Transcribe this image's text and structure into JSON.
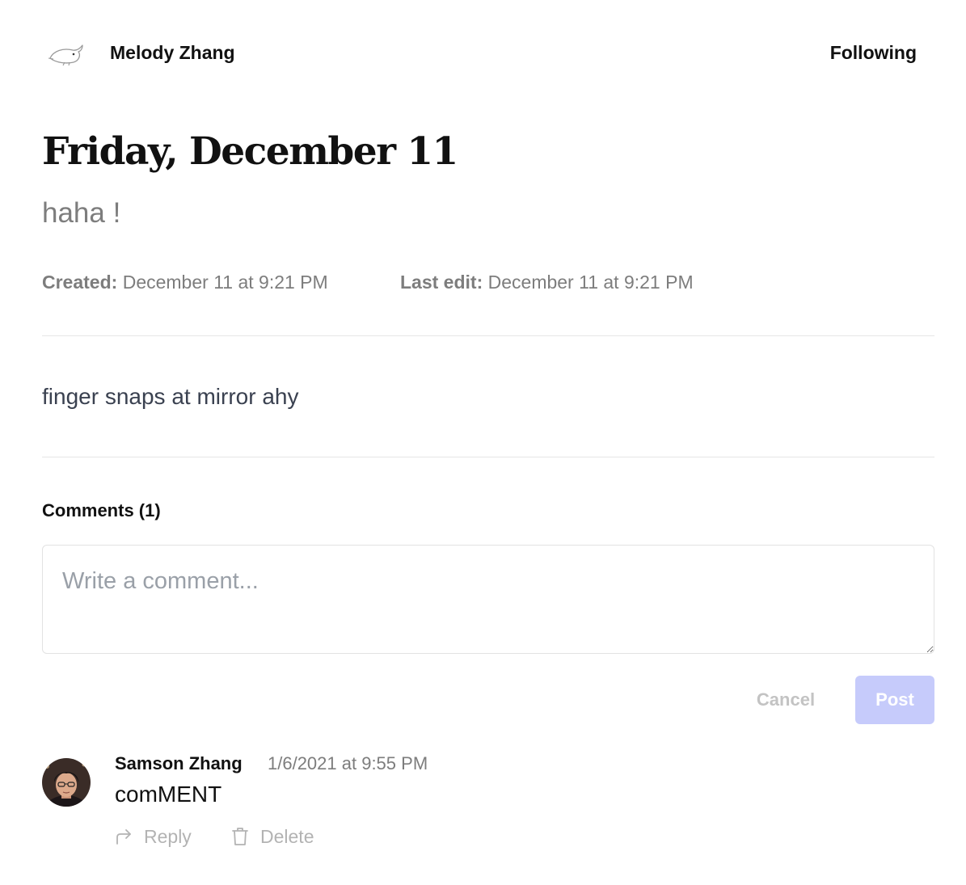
{
  "header": {
    "author_name": "Melody Zhang",
    "follow_label": "Following",
    "logo_icon": "whale-logo-icon"
  },
  "entry": {
    "title": "Friday, December 11",
    "subtitle": "haha !",
    "created_label": "Created:",
    "created_value": "December 11 at 9:21 PM",
    "edited_label": "Last edit:",
    "edited_value": "December 11 at 9:21 PM",
    "body": "finger snaps at mirror ahy"
  },
  "comments": {
    "heading": "Comments (1)",
    "input_placeholder": "Write a comment...",
    "cancel_label": "Cancel",
    "post_label": "Post",
    "post_color": "#c6cbfb",
    "items": [
      {
        "author": "Samson Zhang",
        "timestamp": "1/6/2021 at 9:55 PM",
        "text": "comMENT",
        "reply_label": "Reply",
        "delete_label": "Delete",
        "reply_icon": "reply-arrow-icon",
        "delete_icon": "trash-icon"
      }
    ]
  }
}
